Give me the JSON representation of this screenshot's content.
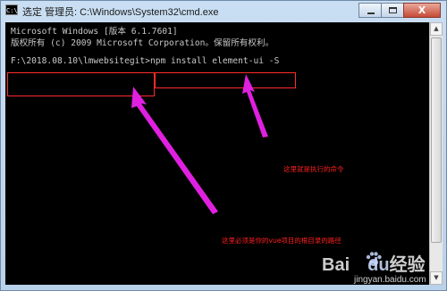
{
  "window": {
    "title": "选定 管理员: C:\\Windows\\System32\\cmd.exe",
    "app_icon_text": "C:\\",
    "close_glyph": "X"
  },
  "console": {
    "lines": [
      "Microsoft Windows [版本 6.1.7601]",
      "版权所有 (c) 2009 Microsoft Corporation。保留所有权利。",
      "F:\\2018.08.10\\lmwebsitegit>npm install element-ui -S"
    ]
  },
  "annotations": {
    "command_note": "这里就是执行的命令",
    "path_note": "这里必须是你的vue项目的根目录的路径",
    "color": "#ff2020",
    "arrow_color": "#e020e0"
  },
  "watermark": {
    "logo_left": "Bai",
    "logo_right": "经验",
    "logo_mid": "du",
    "subtitle": "jingyan.baidu.com"
  }
}
